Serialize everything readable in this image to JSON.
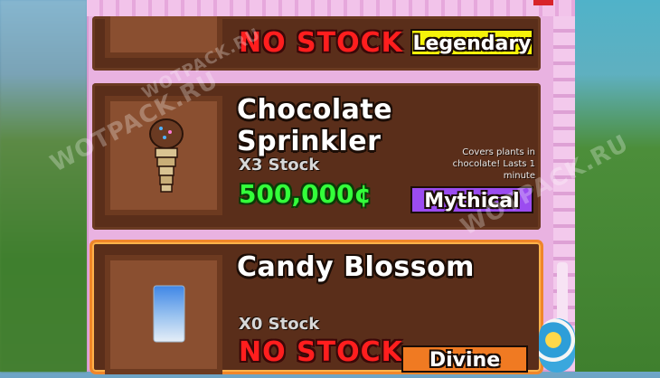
{
  "watermark": "WOTPACK.RU",
  "shop": {
    "items": [
      {
        "name": "",
        "stock": "",
        "price": "NO STOCK",
        "rarity": "Legendary",
        "rarity_color": "#f5f30a",
        "description": ""
      },
      {
        "name": "Chocolate Sprinkler",
        "stock": "X3 Stock",
        "price": "500,000¢",
        "rarity": "Mythical",
        "rarity_color": "#9b4cf0",
        "description": "Covers plants in chocolate! Lasts 1 minute",
        "icon": "chocolate-sprinkler-icon"
      },
      {
        "name": "Candy Blossom",
        "stock": "X0 Stock",
        "price": "NO STOCK",
        "rarity": "Divine",
        "rarity_color": "#f07a22",
        "icon": "candy-blossom-seed-icon",
        "selected": true
      }
    ]
  },
  "colors": {
    "panel_pink": "#e9b2e1",
    "card_brown": "#5a2e1a",
    "price_green": "#33ff3a",
    "no_stock_red": "#ff1e1e"
  }
}
